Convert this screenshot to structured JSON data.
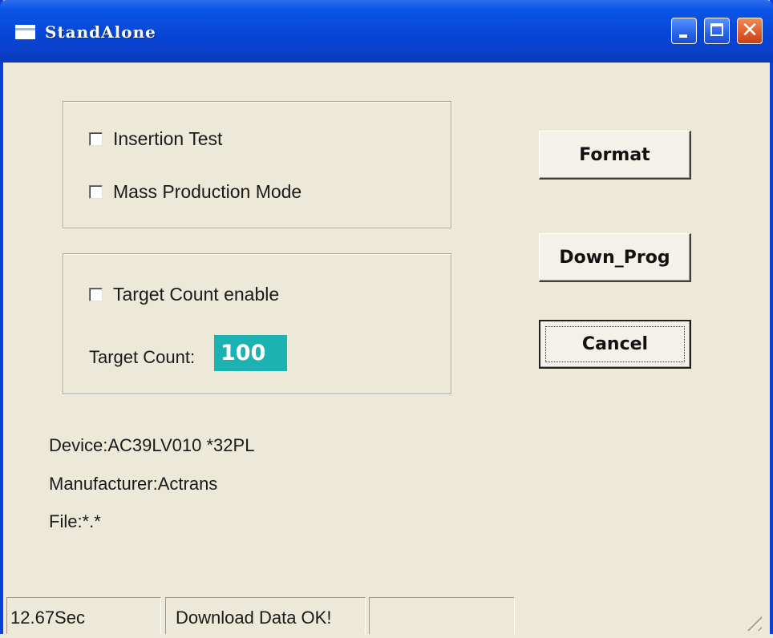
{
  "window": {
    "title": "StandAlone"
  },
  "options": {
    "insertion_test": {
      "label": "Insertion Test",
      "checked": false
    },
    "mass_production": {
      "label": "Mass Production Mode",
      "checked": false
    }
  },
  "target": {
    "enable": {
      "label": "Target Count enable",
      "checked": false
    },
    "count_label": "Target Count:",
    "count_value": "100"
  },
  "buttons": {
    "format": "Format",
    "down_prog": "Down_Prog",
    "cancel": "Cancel"
  },
  "info": {
    "device": "Device:AC39LV010 *32PL",
    "manufacturer": "Manufacturer:Actrans",
    "file": "File:*.*"
  },
  "status": {
    "time": "12.67Sec",
    "message": "Download Data OK!",
    "extra": ""
  },
  "colors": {
    "titlebar": "#0846d6",
    "face": "#ece9d8",
    "highlight": "#1cb2b2"
  }
}
